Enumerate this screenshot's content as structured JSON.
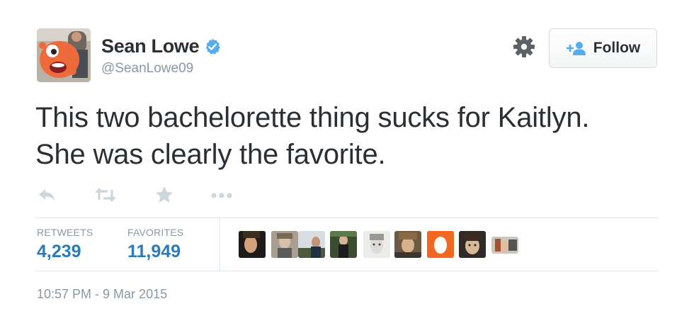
{
  "user": {
    "name": "Sean Lowe",
    "handle": "@SeanLowe09",
    "verified_icon": "verified-badge-icon",
    "verified_color": "#55acee"
  },
  "header": {
    "follow_label": "Follow",
    "settings_icon": "gear-icon"
  },
  "tweet": {
    "lines": [
      "This two bachelorette thing sucks for Kaitlyn.",
      "She was clearly the favorite."
    ]
  },
  "actions": [
    {
      "name": "reply-icon"
    },
    {
      "name": "retweet-icon"
    },
    {
      "name": "favorite-star-icon"
    },
    {
      "name": "more-dots-icon"
    }
  ],
  "stats": {
    "retweets_label": "RETWEETS",
    "retweets_value": "4,239",
    "favorites_label": "FAVORITES",
    "favorites_value": "11,949"
  },
  "timestamp": "10:57 PM - 9 Mar 2015",
  "colors": {
    "link_blue": "#2b7bb9",
    "muted_gray": "#8899a6",
    "text": "#292f33",
    "action_gray": "#ccd6dd"
  }
}
